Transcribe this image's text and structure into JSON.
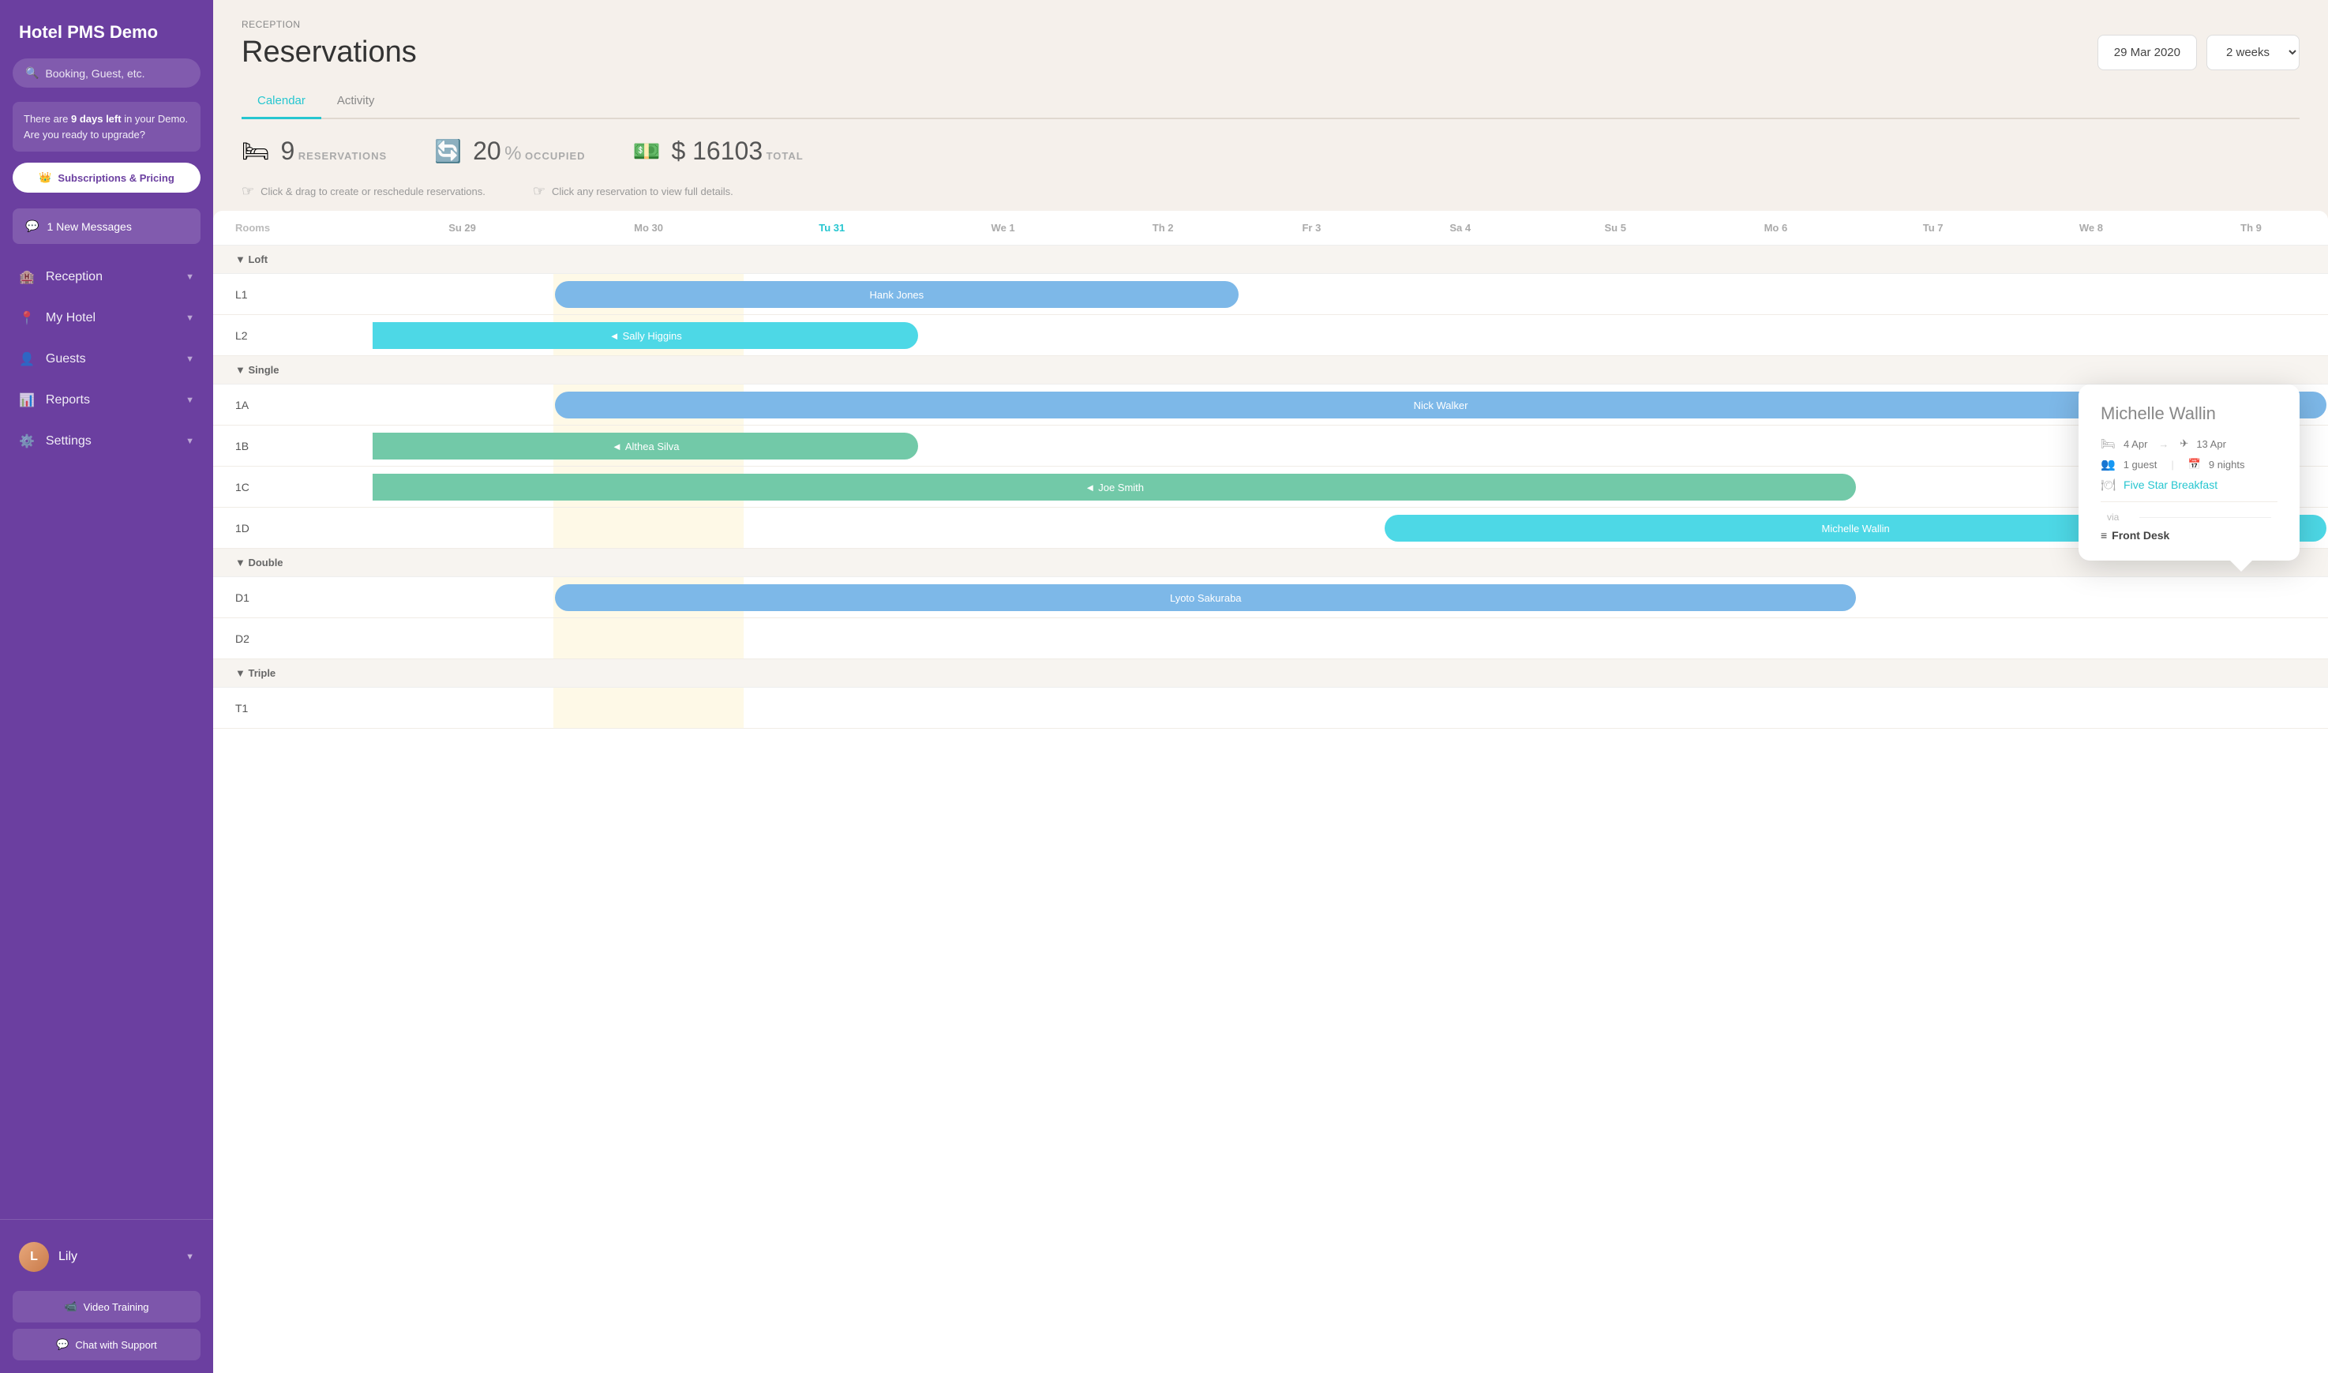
{
  "sidebar": {
    "title": "Hotel PMS Demo",
    "search_placeholder": "Booking, Guest, etc.",
    "demo_notice": "There are ",
    "demo_days": "9 days left",
    "demo_notice2": " in your Demo. Are you ready to upgrade?",
    "upgrade_btn": "Subscriptions & Pricing",
    "messages_btn": "1 New Messages",
    "nav_items": [
      {
        "id": "reception",
        "label": "Reception",
        "icon": "🏨"
      },
      {
        "id": "my-hotel",
        "label": "My Hotel",
        "icon": "📍"
      },
      {
        "id": "guests",
        "label": "Guests",
        "icon": "👤"
      },
      {
        "id": "reports",
        "label": "Reports",
        "icon": "📊"
      },
      {
        "id": "settings",
        "label": "Settings",
        "icon": "⚙️"
      }
    ],
    "user": {
      "name": "Lily",
      "avatar_initials": "L"
    },
    "video_training_btn": "Video Training",
    "chat_support_btn": "Chat with Support"
  },
  "header": {
    "breadcrumb": "RECEPTION",
    "title": "Reservations",
    "date": "29 Mar 2020",
    "weeks": "2 weeks"
  },
  "tabs": [
    {
      "id": "calendar",
      "label": "Calendar",
      "active": true
    },
    {
      "id": "activity",
      "label": "Activity",
      "active": false
    }
  ],
  "stats": {
    "reservations": {
      "count": "9",
      "label": "RESERVATIONS",
      "icon": "🛏"
    },
    "occupied": {
      "percent": "20",
      "label": "OCCUPIED",
      "icon": "🔄"
    },
    "total": {
      "amount": "$ 16103",
      "label": "TOTAL",
      "icon": "💵"
    }
  },
  "hints": [
    {
      "text": "Click & drag to create or reschedule reservations.",
      "icon": "☝"
    },
    {
      "text": "Click any reservation to view full details.",
      "icon": "☝"
    }
  ],
  "calendar": {
    "rooms_label": "Rooms",
    "columns": [
      {
        "label": "Su 29",
        "today": false
      },
      {
        "label": "Mo 30",
        "today": false
      },
      {
        "label": "Tu 31",
        "today": true
      },
      {
        "label": "We 1",
        "today": false
      },
      {
        "label": "Th 2",
        "today": false
      },
      {
        "label": "Fr 3",
        "today": false
      },
      {
        "label": "Sa 4",
        "today": false
      },
      {
        "label": "Su 5",
        "today": false
      },
      {
        "label": "Mo 6",
        "today": false
      },
      {
        "label": "Tu 7",
        "today": false
      },
      {
        "label": "We 8",
        "today": false
      },
      {
        "label": "Th 9",
        "today": false
      }
    ],
    "groups": [
      {
        "name": "Loft",
        "rooms": [
          {
            "id": "L1",
            "reservations": [
              {
                "name": "Hank Jones",
                "color": "blue",
                "start": 1,
                "span": 4
              }
            ]
          },
          {
            "id": "L2",
            "reservations": [
              {
                "name": "Sally Higgins",
                "color": "cyan",
                "start": 0,
                "span": 3
              }
            ]
          }
        ]
      },
      {
        "name": "Single",
        "rooms": [
          {
            "id": "1A",
            "reservations": [
              {
                "name": "Nick Walker",
                "color": "blue",
                "start": 1,
                "span": 11
              }
            ]
          },
          {
            "id": "1B",
            "reservations": [
              {
                "name": "Althea Silva",
                "color": "green",
                "start": 0,
                "span": 3
              }
            ]
          },
          {
            "id": "1C",
            "reservations": [
              {
                "name": "Joe Smith",
                "color": "green",
                "start": 0,
                "span": 9
              }
            ]
          },
          {
            "id": "1D",
            "reservations": [
              {
                "name": "Michelle Wallin",
                "color": "cyan",
                "start": 6,
                "span": 6
              }
            ]
          }
        ]
      },
      {
        "name": "Double",
        "rooms": [
          {
            "id": "D1",
            "reservations": [
              {
                "name": "Lyoto Sakuraba",
                "color": "blue",
                "start": 1,
                "span": 8
              }
            ]
          },
          {
            "id": "D2",
            "reservations": []
          }
        ]
      },
      {
        "name": "Triple",
        "rooms": [
          {
            "id": "T1",
            "reservations": []
          }
        ]
      }
    ]
  },
  "tooltip": {
    "name": "Michelle Wallin",
    "checkin": "4 Apr",
    "checkout": "13 Apr",
    "guests": "1 guest",
    "nights": "9 nights",
    "addon": "Five Star Breakfast",
    "via_label": "via",
    "source_icon": "≡",
    "source": "Front Desk"
  },
  "colors": {
    "purple": "#6b3fa0",
    "cyan": "#26c6d0",
    "blue_bar": "#7db8e8",
    "green_bar": "#72c9a8",
    "cyan_bar": "#4dd8e6"
  }
}
